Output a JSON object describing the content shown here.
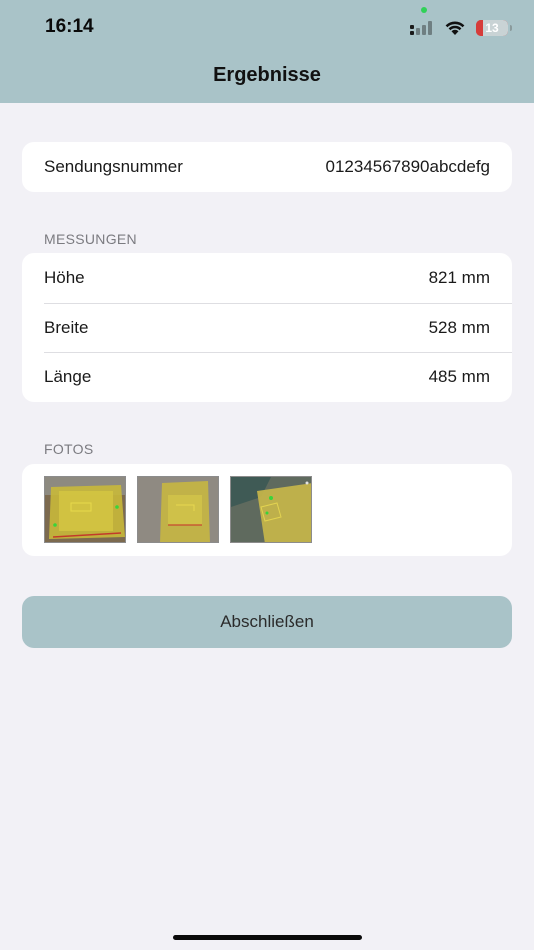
{
  "status_bar": {
    "time": "16:14",
    "battery_level": "13"
  },
  "header": {
    "title": "Ergebnisse"
  },
  "shipment": {
    "label": "Sendungsnummer",
    "value": "01234567890abcdefg"
  },
  "measurements": {
    "section_label": "MESSUNGEN",
    "rows": [
      {
        "label": "Höhe",
        "value": "821 mm"
      },
      {
        "label": "Breite",
        "value": "528 mm"
      },
      {
        "label": "Länge",
        "value": "485 mm"
      }
    ]
  },
  "photos": {
    "section_label": "FOTOS",
    "count": 3
  },
  "actions": {
    "finish_label": "Abschließen"
  },
  "colors": {
    "header": "#a9c3c8",
    "background": "#f2f1f6",
    "button": "#a9c3c8",
    "battery_low": "#d63c3a"
  }
}
